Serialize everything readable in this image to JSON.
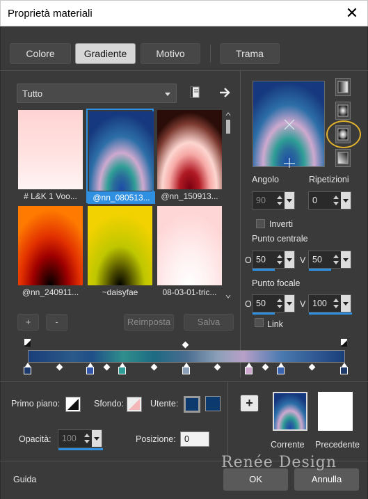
{
  "window": {
    "title": "Proprietà materiali",
    "close_glyph": "✕"
  },
  "tabs": [
    {
      "label": "Colore",
      "active": false
    },
    {
      "label": "Gradiente",
      "active": true
    },
    {
      "label": "Motivo",
      "active": false
    },
    {
      "label": "Trama",
      "active": false
    }
  ],
  "library": {
    "filter_value": "Tutto",
    "items": [
      {
        "label": "# L&K 1 Voo...",
        "selected": false
      },
      {
        "label": "@nn_080513...",
        "selected": true
      },
      {
        "label": "@nn_150913...",
        "selected": false
      },
      {
        "label": "@nn_240911...",
        "selected": false
      },
      {
        "label": "~daisyfae",
        "selected": false
      },
      {
        "label": "08-03-01-tric...",
        "selected": false
      }
    ],
    "add_label": "+",
    "remove_label": "-",
    "reset_label": "Reimposta",
    "save_label": "Salva"
  },
  "gradient": {
    "angle_label": "Angolo",
    "angle_value": "90",
    "repeats_label": "Ripetizioni",
    "repeats_value": "0",
    "invert_label": "Inverti",
    "invert_checked": false,
    "center_label": "Punto centrale",
    "center_h_prefix": "O",
    "center_h": "50",
    "center_v_prefix": "V",
    "center_v": "50",
    "focal_label": "Punto focale",
    "focal_h_prefix": "O",
    "focal_h": "50",
    "focal_v_prefix": "V",
    "focal_v": "100",
    "link_label": "Link",
    "link_checked": false,
    "styles": [
      "linear-gradient-style-icon",
      "rectangular-gradient-style-icon",
      "radial-gradient-style-icon",
      "corner-gradient-style-icon"
    ],
    "selected_style": "radial-gradient-style-icon"
  },
  "bottom": {
    "foreground_label": "Primo piano:",
    "background_label": "Sfondo:",
    "user_label": "Utente:",
    "user_color": "#0c3a6e",
    "opacity_label": "Opacità:",
    "opacity_value": "100",
    "position_label": "Posizione:",
    "position_value": "0",
    "add_swatch_label": "+",
    "current_label": "Corrente",
    "previous_label": "Precedente"
  },
  "footer": {
    "help_label": "Guida",
    "ok_label": "OK",
    "cancel_label": "Annulla"
  },
  "watermark": "Renée Design",
  "colors": {
    "accent": "#2f8fe0",
    "highlight": "#e0b12f",
    "dialog_bg": "#3a3a3a"
  }
}
